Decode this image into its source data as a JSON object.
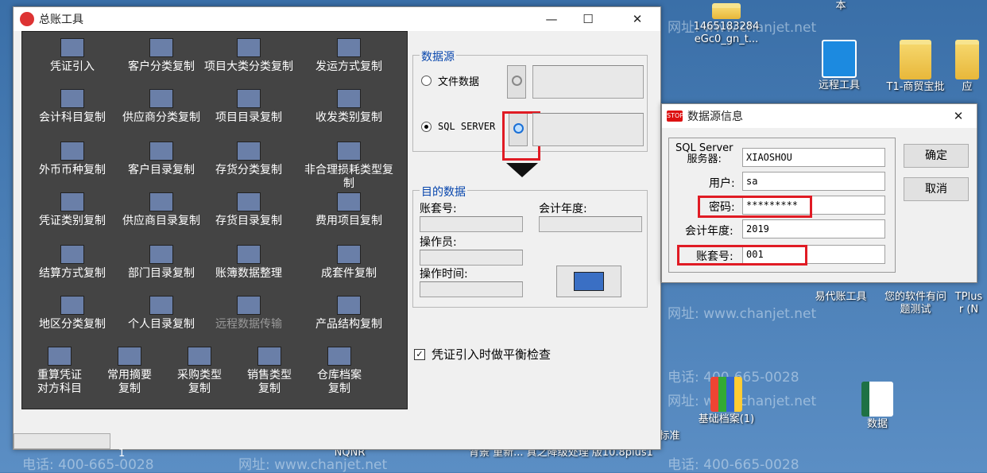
{
  "desktop": {
    "icons": [
      {
        "label": "1465183284\neGc0_gn_t...",
        "kind": "file"
      },
      {
        "label": "本",
        "kind": "folder"
      },
      {
        "label": "远程工具",
        "kind": "app"
      },
      {
        "label": "T1-商贸宝批",
        "kind": "folder"
      },
      {
        "label": "应",
        "kind": "folder"
      },
      {
        "label": "易代账工具",
        "kind": "app"
      },
      {
        "label": "您的软件有问\n题测试",
        "kind": "app"
      },
      {
        "label": "TPlus\nr (N",
        "kind": "app"
      },
      {
        "label": "基础档案(1)",
        "kind": "zip"
      },
      {
        "label": "数据",
        "kind": "excel"
      },
      {
        "label": "NQNR",
        "kind": "file"
      },
      {
        "label": "背景 重新...  真之降级处理 版10.8plus1",
        "kind": "file"
      },
      {
        "label": "题标准",
        "kind": "file"
      },
      {
        "label": "1",
        "kind": "file"
      }
    ],
    "watermark_phone": "电话: 400-665-0028",
    "watermark_site": "网址: www.chanjet.net"
  },
  "main_window": {
    "title": "总账工具",
    "minimize": "—",
    "maximize": "☐",
    "close": "✕",
    "tools": [
      {
        "label": "凭证引入",
        "icon": "voucher-import-icon"
      },
      {
        "label": "客户分类复制",
        "icon": "customer-class-icon"
      },
      {
        "label": "项目大类分类复制",
        "icon": "project-class-icon"
      },
      {
        "label": "发运方式复制",
        "icon": "shipping-icon"
      },
      {
        "label": "会计科目复制",
        "icon": "account-icon"
      },
      {
        "label": "供应商分类复制",
        "icon": "supplier-class-icon"
      },
      {
        "label": "项目目录复制",
        "icon": "project-dir-icon"
      },
      {
        "label": "收发类别复制",
        "icon": "io-type-icon"
      },
      {
        "label": "外币币种复制",
        "icon": "currency-icon"
      },
      {
        "label": "客户目录复制",
        "icon": "customer-dir-icon"
      },
      {
        "label": "存货分类复制",
        "icon": "inventory-class-icon"
      },
      {
        "label": "非合理损耗类型复制",
        "icon": "loss-type-icon"
      },
      {
        "label": "凭证类别复制",
        "icon": "voucher-type-icon"
      },
      {
        "label": "供应商目录复制",
        "icon": "supplier-dir-icon"
      },
      {
        "label": "存货目录复制",
        "icon": "inventory-dir-icon"
      },
      {
        "label": "费用项目复制",
        "icon": "expense-icon"
      },
      {
        "label": "结算方式复制",
        "icon": "settlement-icon"
      },
      {
        "label": "部门目录复制",
        "icon": "department-icon"
      },
      {
        "label": "账簿数据整理",
        "icon": "ledger-icon"
      },
      {
        "label": "成套件复制",
        "icon": "kit-icon"
      },
      {
        "label": "地区分类复制",
        "icon": "region-icon"
      },
      {
        "label": "个人目录复制",
        "icon": "personal-icon"
      },
      {
        "label": "远程数据传输",
        "icon": "remote-icon",
        "disabled": true
      },
      {
        "label": "产品结构复制",
        "icon": "product-icon"
      },
      {
        "label": "重算凭证\n对方科目",
        "icon": "recalc-icon"
      },
      {
        "label": "常用摘要\n复制",
        "icon": "summary-icon"
      },
      {
        "label": "采购类型\n复制",
        "icon": "purchase-icon"
      },
      {
        "label": "销售类型\n复制",
        "icon": "sales-icon"
      },
      {
        "label": "仓库档案\n复制",
        "icon": "warehouse-icon"
      }
    ],
    "source": {
      "legend": "数据源",
      "file_label": "文件数据",
      "sql_label": "SQL SERVER",
      "file_selected": false,
      "sql_selected": true
    },
    "target": {
      "legend": "目的数据",
      "account_set": "账套号:",
      "fiscal_year": "会计年度:",
      "operator": "操作员:",
      "op_time": "操作时间:"
    },
    "balance_check": "凭证引入时做平衡检查",
    "balance_checked": true,
    "status_left": "",
    "status_num": "1"
  },
  "dialog": {
    "title": "数据源信息",
    "server_label": "SQL Server\n服务器:",
    "server_value": "XIAOSHOU",
    "user_label": "用户:",
    "user_value": "sa",
    "password_label": "密码:",
    "password_value": "*********",
    "year_label": "会计年度:",
    "year_value": "2019",
    "account_label": "账套号:",
    "account_value": "001",
    "ok": "确定",
    "cancel": "取消"
  }
}
